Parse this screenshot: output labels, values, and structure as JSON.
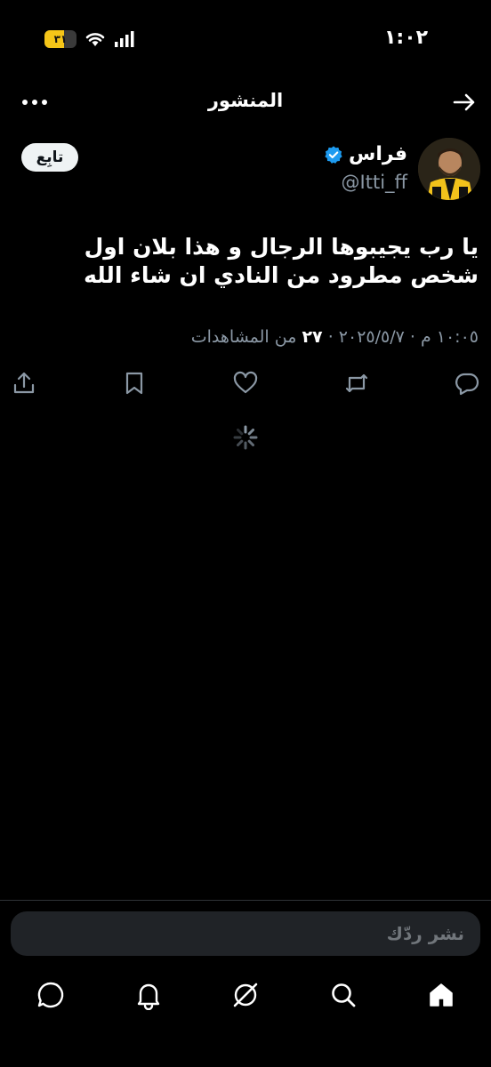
{
  "status_bar": {
    "time": "١:٠٢",
    "battery": "٣١",
    "battery_level": 0.31,
    "accent_color": "#f5c518"
  },
  "header": {
    "title": "المنشور",
    "back_icon": "arrow-right-icon",
    "more_icon": "more-horizontal-icon"
  },
  "author": {
    "name": "فراس",
    "handle": "@Itti_ff",
    "verified": true,
    "follow_label": "تابِع"
  },
  "tweet": {
    "text": "يا رب يجيبوها الرجال و هذا بلان اول شخص مطرود من النادي ان شاء الله",
    "datetime": "١٠:٠٥ م · ٢٠٢٥/٥/٧",
    "views_count": "٢٧",
    "views_label": "من المشاهدات"
  },
  "actions": [
    "reply-icon",
    "retweet-icon",
    "like-icon",
    "bookmark-icon",
    "share-icon"
  ],
  "reply": {
    "placeholder": "نشر ردّك"
  },
  "bottom_nav": [
    "home-icon",
    "search-icon",
    "grok-icon",
    "notifications-icon",
    "messages-icon"
  ],
  "colors": {
    "background": "#000000",
    "text": "#e7e9ea",
    "secondary": "#8b98a5",
    "verified": "#1d9bf0"
  }
}
